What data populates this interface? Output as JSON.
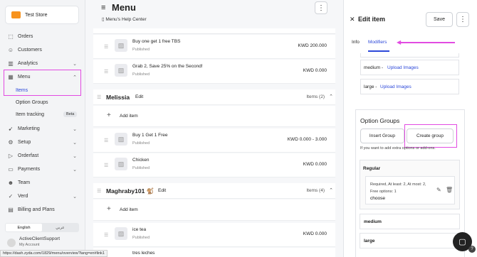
{
  "sidebar": {
    "store_name": "Test Store",
    "items": [
      {
        "label": "Orders"
      },
      {
        "label": "Customers"
      },
      {
        "label": "Analytics"
      },
      {
        "label": "Menu"
      },
      {
        "label": "Marketing"
      },
      {
        "label": "Setup"
      },
      {
        "label": "Orderfast"
      },
      {
        "label": "Payments"
      },
      {
        "label": "Team"
      },
      {
        "label": "Verd"
      },
      {
        "label": "Billing and Plans"
      }
    ],
    "menu_sub": [
      "Items",
      "Option Groups",
      "Item tracking"
    ],
    "beta_badge": "Beta",
    "lang_en": "English",
    "lang_ar": "عربي",
    "user_name": "ActiveClientSupport",
    "user_role": "My Account"
  },
  "status_url": "https://dash.zyda.com/1829/menu/overview?lang=en#link1",
  "main": {
    "title": "Menu",
    "help_link": "Menu's Help Center",
    "rows": [
      {
        "name": "Buy one get 1 free TBS",
        "status": "Published",
        "price": "KWD 200.000"
      },
      {
        "name": "Grab 2, Save 25% on the Second!",
        "status": "Published",
        "price": "KWD 0.000"
      }
    ],
    "categories": [
      {
        "name": "Melissia",
        "edit": "Edit",
        "count": "Items (2)",
        "add_label": "Add item",
        "rows": [
          {
            "name": "Buy 1 Get 1 Free",
            "status": "Published",
            "price": "KWD 0.000 - 3.000"
          },
          {
            "name": "Chicken",
            "status": "Published",
            "price": "KWD 0.000"
          }
        ]
      },
      {
        "name": "Maghraby101 🐒",
        "edit": "Edit",
        "count": "Items (4)",
        "add_label": "Add item",
        "rows": [
          {
            "name": "ice tea",
            "status": "Published",
            "price": "KWD 0.000"
          },
          {
            "name": "tres leches",
            "status": "",
            "price": ""
          }
        ]
      }
    ]
  },
  "panel": {
    "title": "Edit item",
    "save": "Save",
    "tabs": [
      "Info",
      "Modifiers"
    ],
    "variants": [
      {
        "label": "medium -",
        "link": "Upload Images"
      },
      {
        "label": "large -",
        "link": "Upload Images"
      }
    ],
    "option_groups": {
      "title": "Option Groups",
      "insert": "Insert Group",
      "create": "Create group",
      "hint": "If you want to add extra options or add-ons.",
      "group_name": "Regular",
      "group_meta": "Required, At least: 2, At most: 2,",
      "group_free": "Free options: 1",
      "group_choose": "choose",
      "sub_items": [
        "medium",
        "large"
      ]
    }
  },
  "colors": {
    "accent": "#2c48d9",
    "highlight": "#e24be2"
  }
}
